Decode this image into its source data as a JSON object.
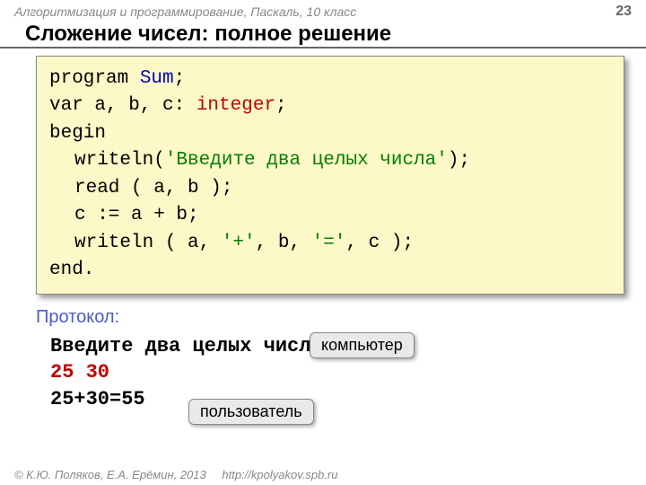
{
  "header": {
    "breadcrumb": "Алгоритмизация и программирование, Паскаль, 10 класс",
    "page": "23"
  },
  "title": "Сложение чисел: полное решение",
  "code": {
    "l1_kw": "program ",
    "l1_name": "Sum",
    "l1_end": ";",
    "l2_a": "var a, b, c: ",
    "l2_type": "integer",
    "l2_end": ";",
    "l3": "begin",
    "l4_a": "writeln(",
    "l4_str": "'Введите два целых числа'",
    "l4_end": ");",
    "l5": "read ( a, b );",
    "l6": "c := a + b;",
    "l7_a": "writeln ( a, ",
    "l7_s1": "'+'",
    "l7_b": ", b, ",
    "l7_s2": "'='",
    "l7_c": ", c );",
    "l8": "end."
  },
  "protocol_label": "Протокол:",
  "output": {
    "prompt": "Введите два целых числа",
    "input": "25 30",
    "result": "25+30=55"
  },
  "tags": {
    "computer": "компьютер",
    "user": "пользователь"
  },
  "footer": {
    "copyright": "© К.Ю. Поляков, Е.А. Ерёмин, 2013",
    "url": "http://kpolyakov.spb.ru"
  }
}
